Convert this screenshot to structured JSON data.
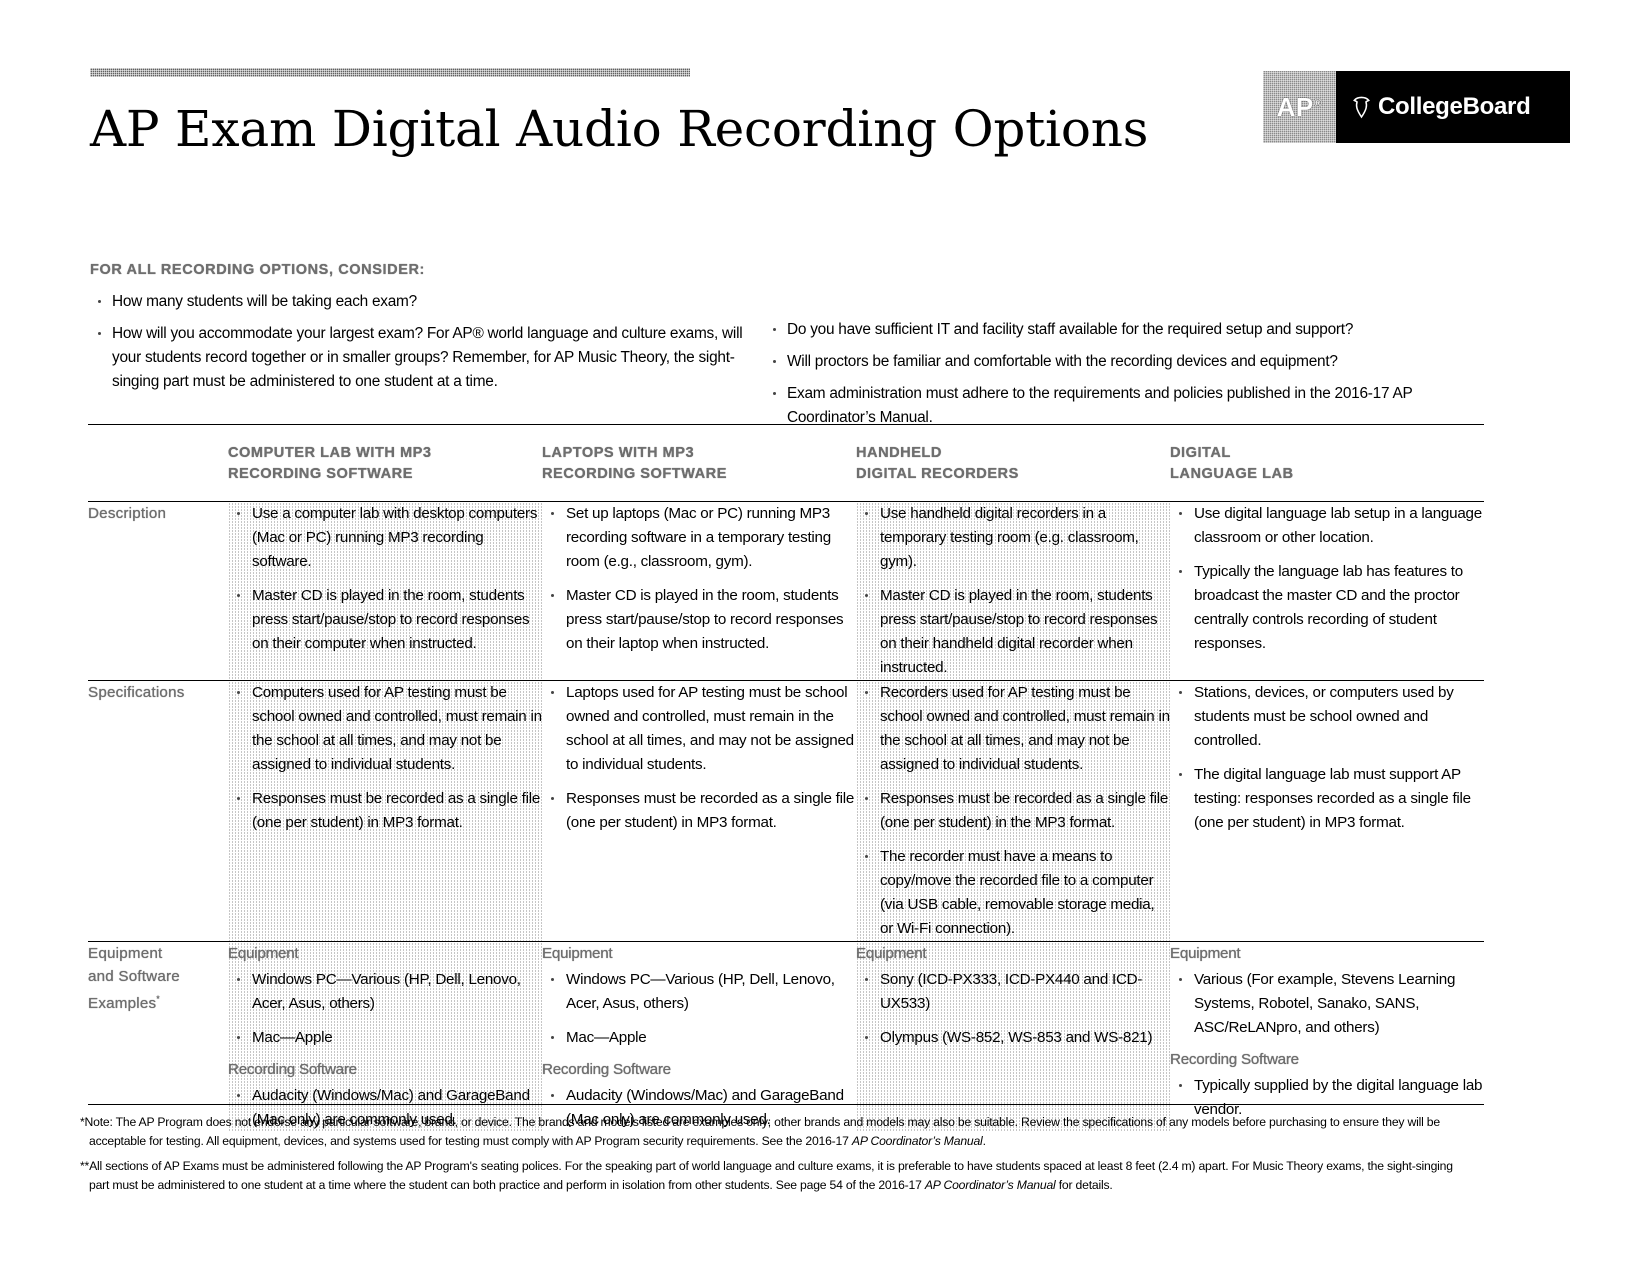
{
  "title": "AP Exam Digital Audio Recording Options",
  "logo": {
    "ap_label": "AP",
    "ap_registered": "®",
    "collegeboard_label": "CollegeBoard",
    "acorn_icon": "acorn-icon",
    "ap_block_color": "#8a8a8a",
    "cb_block_color": "#000000"
  },
  "consider": {
    "heading": "FOR ALL RECORDING OPTIONS, CONSIDER:",
    "left_items": [
      "How many students will be taking each exam?",
      "How will you accommodate your largest exam? For AP® world language and culture exams, will your students record together or in smaller groups? Remember, for AP Music Theory, the sight-singing part must be administered to one student at a time."
    ],
    "right_items": [
      "Do you have sufficient IT and facility staff available for the required setup and support?",
      "Will proctors be familiar and comfortable with the recording devices and equipment?",
      "Exam administration must adhere to the requirements and policies published in the 2016-17 AP Coordinator’s Manual."
    ]
  },
  "table": {
    "columns": [
      {
        "line1": "COMPUTER LAB WITH MP3",
        "line2": "RECORDING SOFTWARE",
        "shaded": true
      },
      {
        "line1": "LAPTOPS WITH MP3",
        "line2": "RECORDING SOFTWARE",
        "shaded": false
      },
      {
        "line1": "HANDHELD",
        "line2": "DIGITAL RECORDERS",
        "shaded": true
      },
      {
        "line1": "DIGITAL",
        "line2": "LANGUAGE LAB",
        "shaded": false
      }
    ],
    "rows": {
      "description": {
        "label": "Description",
        "cells": [
          [
            "Use a computer lab with desktop computers (Mac or PC) running MP3 recording software.",
            "Master CD is played in the room, students press start/pause/stop to record responses on their computer when instructed."
          ],
          [
            "Set up laptops (Mac or PC) running MP3 recording software in a temporary testing room (e.g., classroom, gym).",
            "Master CD is played in the room, students press start/pause/stop to record responses on their laptop when instructed."
          ],
          [
            "Use handheld digital recorders in a temporary testing room (e.g. classroom, gym).",
            "Master CD is played in the room, students press start/pause/stop to record responses on their handheld digital recorder when instructed."
          ],
          [
            "Use digital language lab setup in a language classroom or other location.",
            "Typically the language lab has features to broadcast the master CD and the proctor centrally controls recording of student responses."
          ]
        ]
      },
      "specifications": {
        "label": "Specifications",
        "cells": [
          [
            "Computers used for AP testing must be school owned and controlled, must remain in the school at all times, and may not be assigned to individual students.",
            "Responses must be recorded as a single file (one per student) in MP3 format."
          ],
          [
            "Laptops used for AP testing must be school owned and controlled, must remain in the school at all times, and may not be assigned to individual students.",
            "Responses must be recorded as a single file (one per student) in MP3 format."
          ],
          [
            "Recorders used for AP testing must be school owned and controlled, must remain in the school at all times, and may not be assigned to individual students.",
            "Responses must be recorded as a single file (one per student) in the MP3 format.",
            "The recorder must have a means to copy/move the recorded file to a computer (via USB cable, removable storage media, or Wi-Fi connection)."
          ],
          [
            "Stations, devices, or computers used by students must be school owned and controlled.",
            "The digital language lab must support AP testing: responses recorded as a single file (one per student) in MP3 format."
          ]
        ]
      },
      "equipment": {
        "label_line1": "Equipment",
        "label_line2": "and Software",
        "label_line3": "Examples",
        "label_sup": "*",
        "equipment_subhead": "Equipment",
        "software_subhead": "Recording Software",
        "cells": [
          {
            "equipment": [
              "Windows PC—Various (HP, Dell, Lenovo, Acer, Asus, others)",
              "Mac—Apple"
            ],
            "software": [
              "Audacity (Windows/Mac) and GarageBand (Mac only) are commonly used."
            ]
          },
          {
            "equipment": [
              "Windows PC—Various (HP, Dell, Lenovo, Acer, Asus, others)",
              "Mac—Apple"
            ],
            "software": [
              "Audacity (Windows/Mac) and GarageBand (Mac only) are commonly used."
            ]
          },
          {
            "equipment": [
              "Sony (ICD-PX333, ICD-PX440 and ICD-UX533)",
              "Olympus (WS-852, WS-853 and WS-821)"
            ],
            "software": []
          },
          {
            "equipment": [
              "Various (For example, Stevens Learning Systems, Robotel, Sanako, SANS, ASC/ReLANpro, and others)"
            ],
            "software": [
              "Typically supplied by the digital language lab vendor."
            ]
          }
        ]
      }
    }
  },
  "footnotes": {
    "one_a": "*Note: The AP Program does not endorse any particular software, brand, or device. The brands and models listed are examples only; other brands and models may also be suitable. Review the specifications of any models before purchasing to ensure they will be",
    "one_b_pre": "acceptable for testing. All equipment, devices, and systems used for testing must comply with AP Program security requirements. See the 2016-17 ",
    "one_b_ital": "AP Coordinator’s Manual",
    "one_b_post": ".",
    "two_a": "**All sections of AP Exams must be administered following the AP Program's seating polices. For the speaking part of world language and culture exams, it is preferable to have students spaced at least 8 feet (2.4 m) apart. For Music Theory exams, the sight-singing",
    "two_b_pre": "part must be administered to one student at a time where the student can both practice and perform in isolation from other students. See page 54 of the 2016-17 ",
    "two_b_ital": "AP Coordinator’s Manual",
    "two_b_post": " for details."
  }
}
